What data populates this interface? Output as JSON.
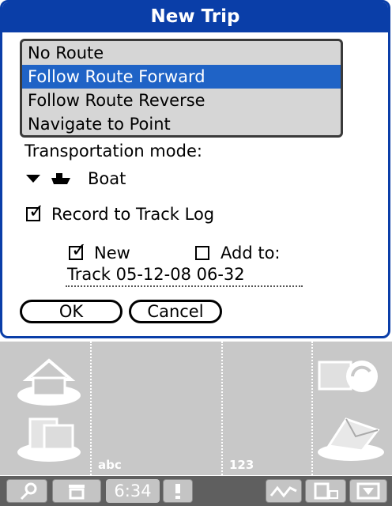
{
  "dialog": {
    "title": "New Trip",
    "route_options": [
      {
        "label": "No Route",
        "selected": false
      },
      {
        "label": "Follow Route Forward",
        "selected": true
      },
      {
        "label": "Follow Route Reverse",
        "selected": false
      },
      {
        "label": "Navigate to Point",
        "selected": false
      }
    ],
    "transport_label": "Transportation mode:",
    "transport_value": "Boat",
    "record_label": "Record to Track Log",
    "record_checked": true,
    "new_label": "New",
    "new_checked": true,
    "addto_label": "Add to:",
    "addto_checked": false,
    "track_name": "Track 05-12-08 06-32",
    "ok_label": "OK",
    "cancel_label": "Cancel"
  },
  "silk": {
    "abc_label": "abc",
    "num_label": "123"
  },
  "statusbar": {
    "time": "6:34"
  },
  "colors": {
    "title_bar": "#0a3ea8",
    "selection": "#1f63c6",
    "list_bg": "#d6d6d6",
    "silk_bg": "#c8c8c8",
    "status_bg": "#5f5f5f"
  }
}
